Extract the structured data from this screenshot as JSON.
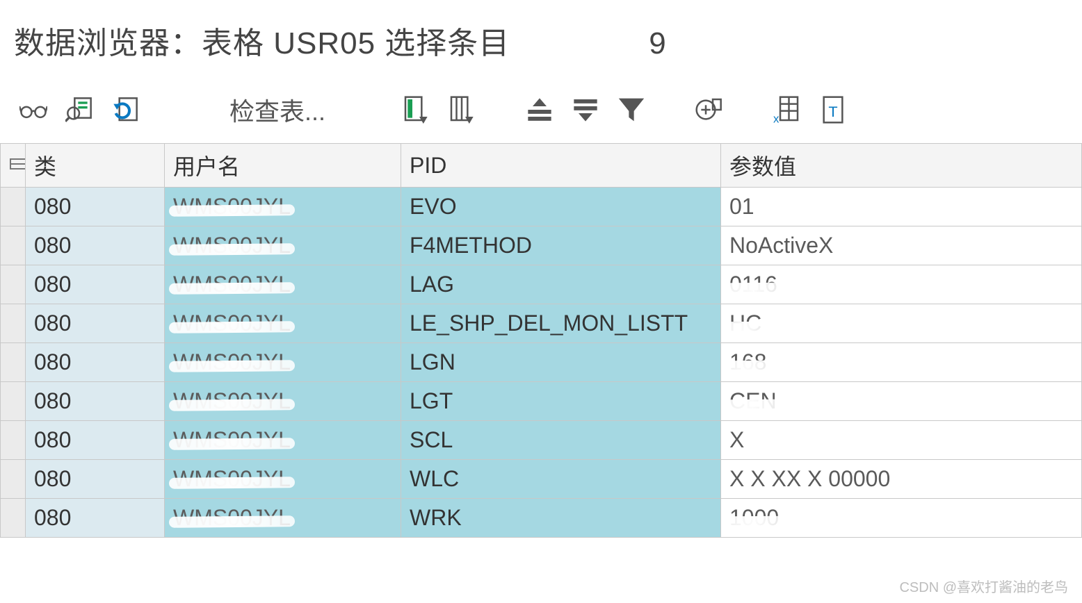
{
  "header": {
    "title": "数据浏览器：表格 USR05 选择条目",
    "count": "9"
  },
  "toolbar": {
    "check_table": "检查表...",
    "icons": {
      "display": "glasses-icon",
      "find": "find-icon",
      "refresh": "refresh-icon",
      "col_sel": "column-select-icon",
      "col_all": "column-all-icon",
      "sort_asc": "sort-asc-icon",
      "sort_desc": "sort-desc-icon",
      "filter": "filter-icon",
      "total": "sum-icon",
      "export": "export-excel-icon",
      "text": "text-mode-icon"
    }
  },
  "grid": {
    "headers": {
      "class": "类",
      "user": "用户名",
      "pid": "PID",
      "value": "参数值"
    },
    "rows": [
      {
        "class": "080",
        "user": "WMS00JYL",
        "pid": "EVO",
        "value": "01",
        "redact_user": true,
        "redact_val": false
      },
      {
        "class": "080",
        "user": "WMS00JYL",
        "pid": "F4METHOD",
        "value": "NoActiveX",
        "redact_user": true,
        "redact_val": false
      },
      {
        "class": "080",
        "user": "WMS00JYL",
        "pid": "LAG",
        "value": "0116",
        "redact_user": true,
        "redact_val": true
      },
      {
        "class": "080",
        "user": "WMS00JYL",
        "pid": "LE_SHP_DEL_MON_LISTT",
        "value": "HC",
        "redact_user": true,
        "redact_val": true
      },
      {
        "class": "080",
        "user": "WMS00JYL",
        "pid": "LGN",
        "value": "168",
        "redact_user": true,
        "redact_val": true
      },
      {
        "class": "080",
        "user": "WMS00JYL",
        "pid": "LGT",
        "value": "CEN",
        "redact_user": true,
        "redact_val": true
      },
      {
        "class": "080",
        "user": "WMS00JYL",
        "pid": "SCL",
        "value": "X",
        "redact_user": true,
        "redact_val": false
      },
      {
        "class": "080",
        "user": "WMS00JYL",
        "pid": "WLC",
        "value": "X   X  XX   X 00000",
        "redact_user": true,
        "redact_val": false
      },
      {
        "class": "080",
        "user": "WMS00JYL",
        "pid": "WRK",
        "value": "1000",
        "redact_user": true,
        "redact_val": true
      }
    ]
  },
  "watermark": "CSDN @喜欢打酱油的老鸟"
}
